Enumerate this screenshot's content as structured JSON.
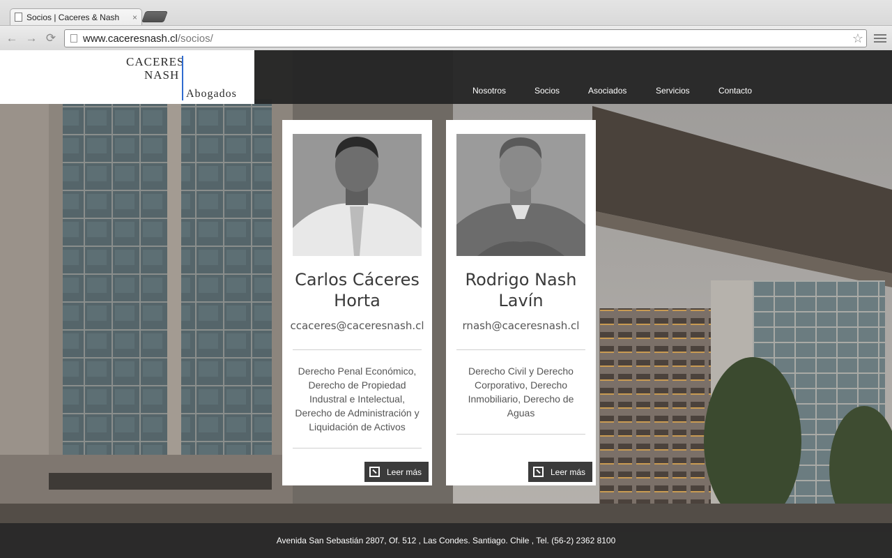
{
  "browser": {
    "tab_title": "Socios | Caceres & Nash",
    "tab_close": "×",
    "url_host": "www.caceresnash.cl",
    "url_path": "/socios/",
    "back": "←",
    "forward": "→",
    "reload": "⟳",
    "star": "☆"
  },
  "logo": {
    "line1": "CACERES",
    "line2": "NASH",
    "line3": "Abogados",
    "accent_color": "#2f6bd0"
  },
  "nav": {
    "items": [
      {
        "label": "Nosotros"
      },
      {
        "label": "Socios"
      },
      {
        "label": "Asociados"
      },
      {
        "label": "Servicios"
      },
      {
        "label": "Contacto"
      }
    ]
  },
  "partners": [
    {
      "name_line1": "Carlos Cáceres",
      "name_line2": "Horta",
      "email": "ccaceres@caceresnash.cl",
      "areas": [
        "Derecho Penal Económico,",
        "Derecho de Propiedad",
        "Industral e Intelectual,",
        "Derecho de Administración y",
        "Liquidación de Activos"
      ],
      "more_label": "Leer más"
    },
    {
      "name_line1": "Rodrigo Nash",
      "name_line2": "Lavín",
      "email": "rnash@caceresnash.cl",
      "areas": [
        "Derecho Civil y Derecho",
        "Corporativo, Derecho",
        "Inmobiliario, Derecho de",
        "Aguas"
      ],
      "more_label": "Leer más"
    }
  ],
  "footer": {
    "address": "Avenida San Sebastián 2807, Of. 512 , Las Condes. Santiago. Chile , Tel. (56-2) 2362 8100"
  }
}
